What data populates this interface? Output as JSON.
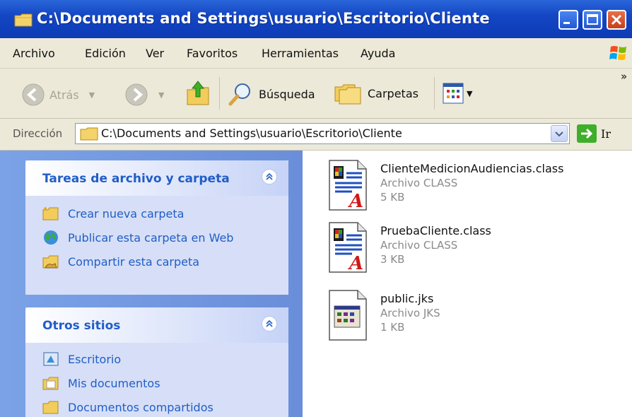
{
  "window": {
    "title": "C:\\Documents and Settings\\usuario\\Escritorio\\Cliente"
  },
  "menu": {
    "items": [
      "Archivo",
      "Edición",
      "Ver",
      "Favoritos",
      "Herramientas",
      "Ayuda"
    ]
  },
  "toolbar": {
    "back_label": "Atrás",
    "search_label": "Búsqueda",
    "folders_label": "Carpetas",
    "overflow": "»"
  },
  "address": {
    "label": "Dirección",
    "path": "C:\\Documents and Settings\\usuario\\Escritorio\\Cliente",
    "go_label": "Ir"
  },
  "tasks_panel": {
    "title": "Tareas de archivo y carpeta",
    "items": [
      "Crear nueva carpeta",
      "Publicar esta carpeta en Web",
      "Compartir esta carpeta"
    ]
  },
  "places_panel": {
    "title": "Otros sitios",
    "items": [
      "Escritorio",
      "Mis documentos",
      "Documentos compartidos"
    ]
  },
  "files": [
    {
      "name": "ClienteMedicionAudiencias.class",
      "type": "Archivo CLASS",
      "size": "5 KB",
      "icon": "class-file-icon"
    },
    {
      "name": "PruebaCliente.class",
      "type": "Archivo CLASS",
      "size": "3 KB",
      "icon": "class-file-icon"
    },
    {
      "name": "public.jks",
      "type": "Archivo JKS",
      "size": "1 KB",
      "icon": "jks-file-icon"
    }
  ],
  "colors": {
    "titlebar": "#0d3bb5",
    "chrome": "#ece9d8",
    "task_link": "#215dc6",
    "left_pane": "#6a8ed9"
  }
}
